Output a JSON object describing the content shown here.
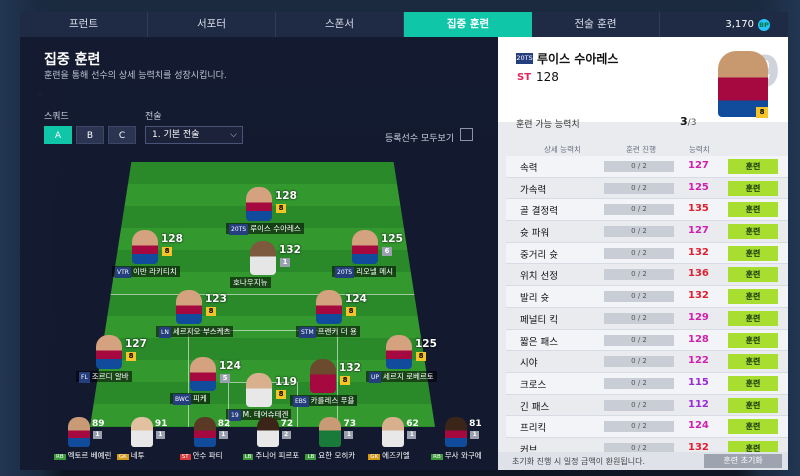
{
  "tabs": [
    "프런트",
    "서포터",
    "스폰서",
    "집중 훈련",
    "전술 훈련"
  ],
  "active_tab": 3,
  "coins": "3,170",
  "coin_icon": "bp-coin-icon",
  "page": {
    "title": "집중 훈련",
    "subtitle": "훈련을 통해 선수의 상세 능력치를 성장시킵니다."
  },
  "squad": {
    "label": "스쿼드",
    "options": [
      "A",
      "B",
      "C"
    ],
    "selected": "A"
  },
  "tactic": {
    "label": "전술",
    "value": "1. 기본 전술"
  },
  "show_all": {
    "label": "등록선수 모두보기",
    "checked": false
  },
  "players": [
    {
      "name": "루이스 수아레스",
      "ovr": "128",
      "lvl": "8",
      "season": "20TS"
    },
    {
      "name": "이반 라키티치",
      "ovr": "128",
      "lvl": "8",
      "season": "VTR"
    },
    {
      "name": "호나우지뉴",
      "ovr": "132",
      "lvl": "1",
      "season": ""
    },
    {
      "name": "리오넬 메시",
      "ovr": "125",
      "lvl": "6",
      "season": "20TS"
    },
    {
      "name": "세르지오 부스케츠",
      "ovr": "123",
      "lvl": "8",
      "season": "LN"
    },
    {
      "name": "프렌키 더 용",
      "ovr": "124",
      "lvl": "8",
      "season": "STM"
    },
    {
      "name": "조르디 알바",
      "ovr": "127",
      "lvl": "8",
      "season": "FL"
    },
    {
      "name": "피케",
      "ovr": "124",
      "lvl": "5",
      "season": "BWC"
    },
    {
      "name": "M. 테어슈테겐",
      "ovr": "119",
      "lvl": "8",
      "season": "19"
    },
    {
      "name": "카를레스 푸욜",
      "ovr": "132",
      "lvl": "8",
      "season": "EBS"
    },
    {
      "name": "세르지 로베르토",
      "ovr": "125",
      "lvl": "8",
      "season": "UP"
    }
  ],
  "bench": [
    {
      "name": "엑토르 베예린",
      "ovr": "89",
      "lvl": "1",
      "pos": "RB"
    },
    {
      "name": "네투",
      "ovr": "91",
      "lvl": "1",
      "pos": "GK"
    },
    {
      "name": "안수 파티",
      "ovr": "82",
      "lvl": "1",
      "pos": "ST"
    },
    {
      "name": "주니어 피르포",
      "ovr": "72",
      "lvl": "2",
      "pos": "LB"
    },
    {
      "name": "요한 모히카",
      "ovr": "73",
      "lvl": "1",
      "pos": "LB"
    },
    {
      "name": "에즈키엘",
      "ovr": "62",
      "lvl": "1",
      "pos": "GK"
    },
    {
      "name": "무사 와구에",
      "ovr": "81",
      "lvl": "1",
      "pos": "RB"
    }
  ],
  "detail": {
    "season": "20TS",
    "name": "루이스 수아레스",
    "pos": "ST",
    "ovr": "128",
    "number": "9",
    "lvl": "8",
    "avail_label": "훈련 가능 능력치",
    "avail_value": "3",
    "avail_total": "/3",
    "columns": {
      "stat": "상세 능력치",
      "progress": "훈련 진행",
      "value": "능력치"
    },
    "stats": [
      {
        "name": "속력",
        "prog": "0 / 2",
        "val": "127",
        "color": "#d11fae"
      },
      {
        "name": "가속력",
        "prog": "0 / 2",
        "val": "125",
        "color": "#d11fae"
      },
      {
        "name": "골 결정력",
        "prog": "0 / 2",
        "val": "135",
        "color": "#e02030"
      },
      {
        "name": "슛 파워",
        "prog": "0 / 2",
        "val": "127",
        "color": "#d11fae"
      },
      {
        "name": "중거리 슛",
        "prog": "0 / 2",
        "val": "132",
        "color": "#e02030"
      },
      {
        "name": "위치 선정",
        "prog": "0 / 2",
        "val": "136",
        "color": "#e02030"
      },
      {
        "name": "발리 슛",
        "prog": "0 / 2",
        "val": "132",
        "color": "#e02030"
      },
      {
        "name": "페널티 킥",
        "prog": "0 / 2",
        "val": "129",
        "color": "#d11fae"
      },
      {
        "name": "짧은 패스",
        "prog": "0 / 2",
        "val": "128",
        "color": "#d11fae"
      },
      {
        "name": "시야",
        "prog": "0 / 2",
        "val": "122",
        "color": "#d11fae"
      },
      {
        "name": "크로스",
        "prog": "0 / 2",
        "val": "115",
        "color": "#9b2ad6"
      },
      {
        "name": "긴 패스",
        "prog": "0 / 2",
        "val": "112",
        "color": "#9b2ad6"
      },
      {
        "name": "프리킥",
        "prog": "0 / 2",
        "val": "124",
        "color": "#d11fae"
      },
      {
        "name": "커브",
        "prog": "0 / 2",
        "val": "132",
        "color": "#e02030"
      }
    ],
    "train_label": "훈련",
    "footer_text": "초기화 진행 시 일정 금액이 환원됩니다.",
    "reset_label": "훈련 초기화"
  }
}
